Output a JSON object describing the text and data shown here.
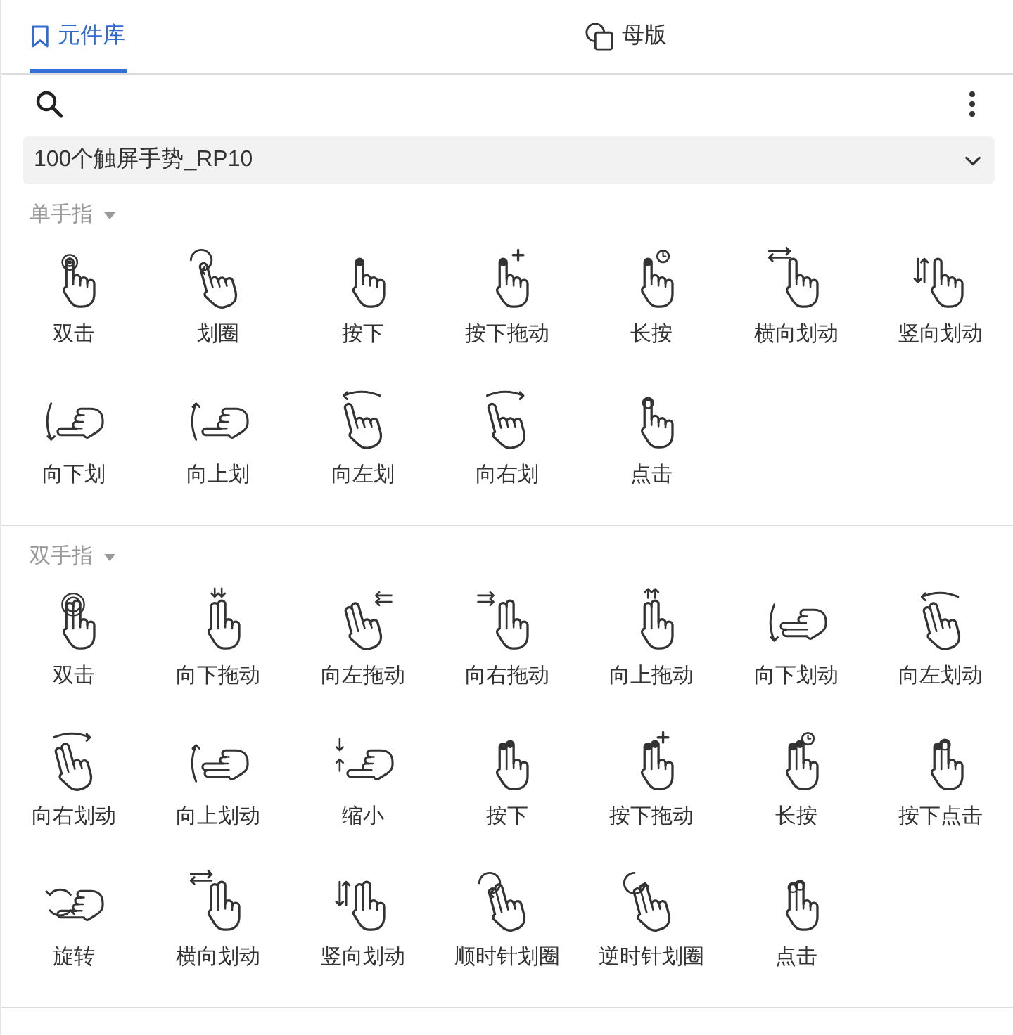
{
  "tabs": [
    {
      "label": "元件库",
      "selected": true
    },
    {
      "label": "母版",
      "selected": false
    }
  ],
  "library": {
    "value": "100个触屏手势_RP10"
  },
  "sections": [
    {
      "title": "单手指",
      "expanded": true,
      "items": [
        "双击",
        "划圈",
        "按下",
        "按下拖动",
        "长按",
        "横向划动",
        "竖向划动",
        "向下划",
        "向上划",
        "向左划",
        "向右划",
        "点击"
      ]
    },
    {
      "title": "双手指",
      "expanded": true,
      "items": [
        "双击",
        "向下拖动",
        "向左拖动",
        "向右拖动",
        "向上拖动",
        "向下划动",
        "向左划动",
        "向右划动",
        "向上划动",
        "缩小",
        "按下",
        "按下拖动",
        "长按",
        "按下点击",
        "旋转",
        "横向划动",
        "竖向划动",
        "顺时针划圈",
        "逆时针划圈",
        "点击"
      ]
    }
  ]
}
